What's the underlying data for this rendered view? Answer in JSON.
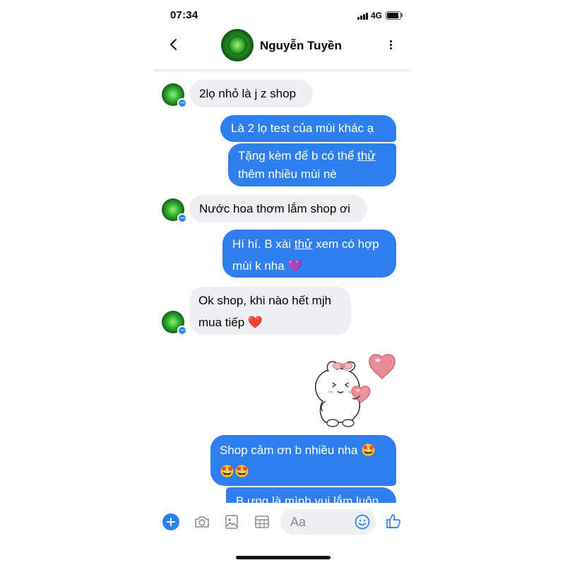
{
  "status_bar": {
    "time": "07:34",
    "network": "4G"
  },
  "header": {
    "contact_name": "Nguyễn Tuyền",
    "back_icon": "chevron-left-icon",
    "more_icon": "more-vertical-icon"
  },
  "messages": [
    {
      "sender": "contact",
      "lines": [
        "2lọ nhỏ là j z shop"
      ]
    },
    {
      "sender": "me",
      "lines": [
        "Là 2 lọ test của mùi khác ạ"
      ]
    },
    {
      "sender": "me",
      "lines": [
        "Tặng kèm để b có thể thử",
        "thêm nhiều mùi nè"
      ]
    },
    {
      "sender": "contact",
      "lines": [
        "Nước hoa thơm lắm shop ơi"
      ]
    },
    {
      "sender": "me",
      "lines": [
        "Hí hí. B xài thử xem có hợp",
        "mùi k nha 💜"
      ]
    },
    {
      "sender": "contact",
      "lines": [
        "Ok shop, khi nào hết mjh",
        "mua tiếp ❤️"
      ]
    },
    {
      "sender": "me",
      "type": "sticker",
      "sticker": "bunny-with-hearts-sticker"
    },
    {
      "sender": "me",
      "lines": [
        "Shop cảm ơn b nhiều nha 🤩",
        "🤩🤩"
      ]
    },
    {
      "sender": "me",
      "lines": [
        "B ưng là mình vui lắm luôn"
      ]
    }
  ],
  "composer": {
    "placeholder": "Aa",
    "icons": [
      "plus-icon",
      "camera-icon",
      "gallery-icon",
      "sticker-grid-icon",
      "emoji-icon",
      "thumbs-up-icon"
    ]
  },
  "colors": {
    "outgoing_bubble": "#2f7ff0",
    "incoming_bubble": "#eeeff2",
    "accent": "#2f7ff0"
  }
}
